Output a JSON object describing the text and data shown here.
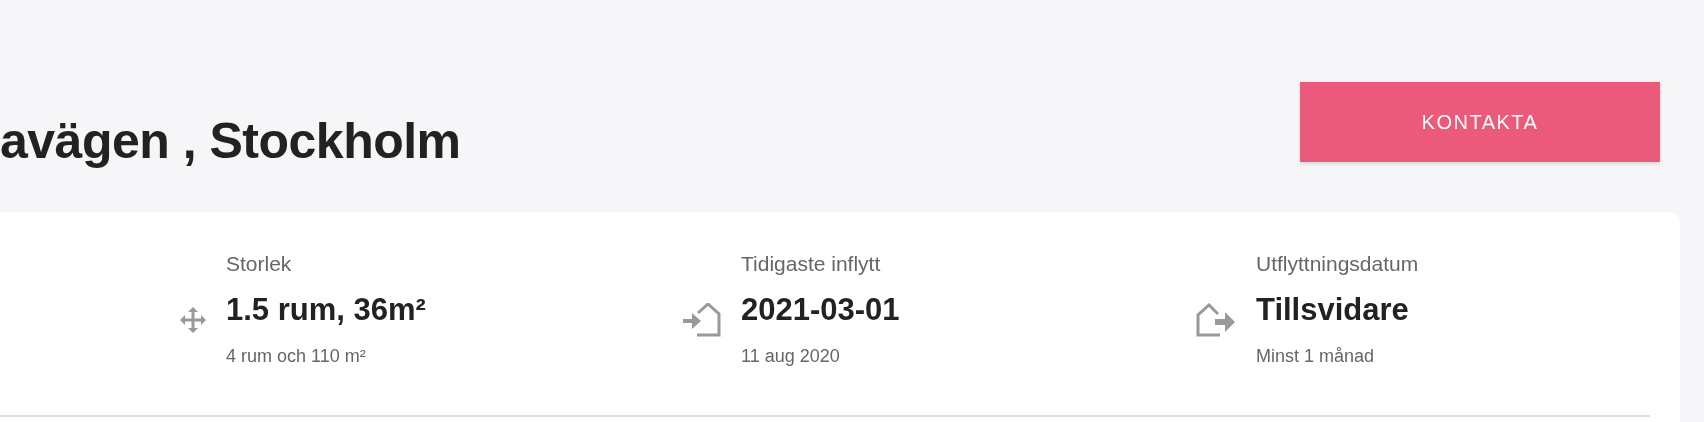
{
  "title": "avägen , Stockholm",
  "contact_button": {
    "label": "KONTAKTA"
  },
  "facts": [
    {
      "kind": "size",
      "label": "Storlek",
      "value": "1.5 rum, 36m²",
      "note": "4 rum och 110 m²"
    },
    {
      "kind": "move-in",
      "label": "Tidigaste inflytt",
      "value": "2021-03-01",
      "note": "11 aug 2020"
    },
    {
      "kind": "move-out",
      "label": "Utflyttningsdatum",
      "value": "Tillsvidare",
      "note": "Minst 1 månad"
    }
  ]
}
